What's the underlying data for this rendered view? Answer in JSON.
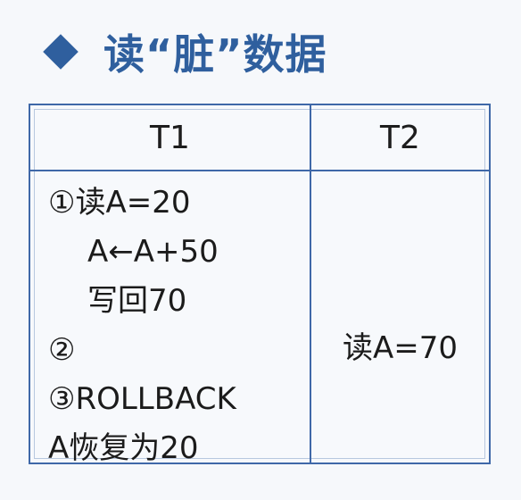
{
  "slide": {
    "title": "读“脏”数据"
  },
  "table": {
    "headers": [
      "T1",
      "T2"
    ],
    "t1_lines": [
      "①读A=20",
      "A←A+50",
      "写回70",
      "②",
      "③ROLLBACK",
      "A恢复为20"
    ],
    "t2_cell": "读A=70"
  }
}
